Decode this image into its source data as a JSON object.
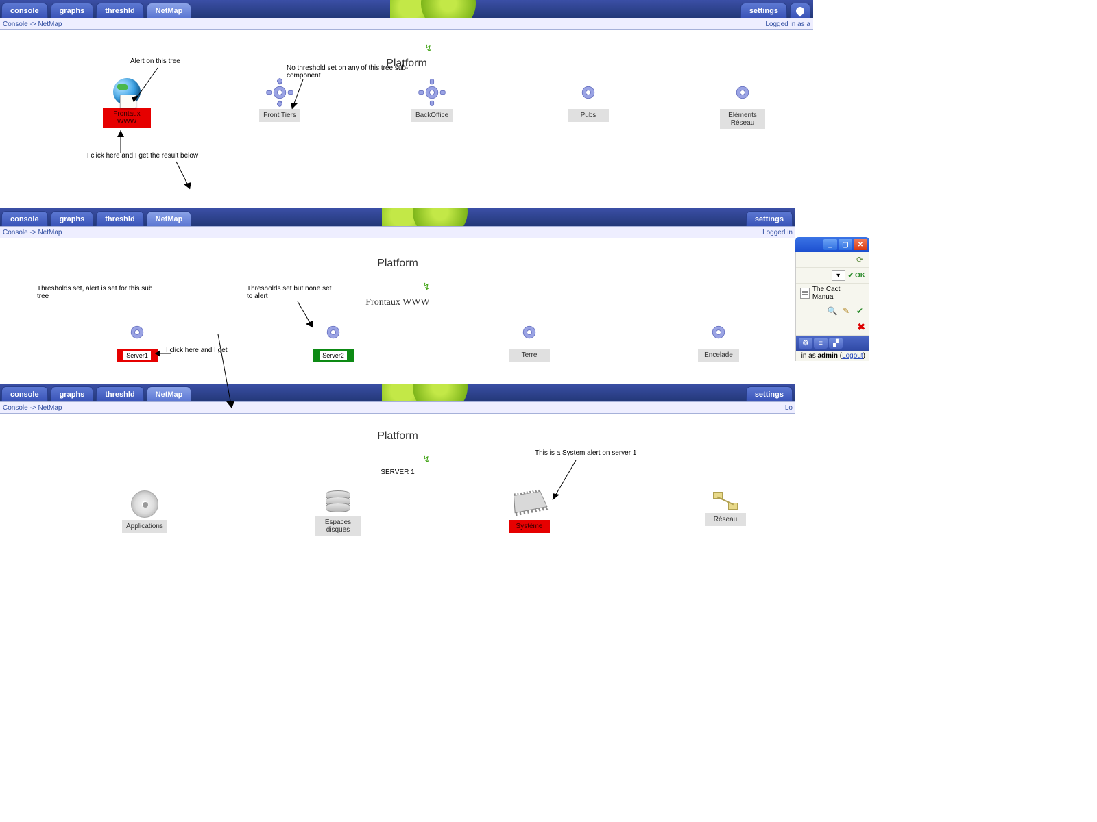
{
  "nav": {
    "tabs": [
      "console",
      "graphs",
      "threshld",
      "NetMap"
    ],
    "active": "NetMap",
    "settings": "settings"
  },
  "breadcrumb": {
    "console": "Console",
    "sep": " -> ",
    "page": "NetMap",
    "logged_a": "Logged in as a",
    "logged_in": "Logged in"
  },
  "view1": {
    "title": "Platform",
    "nodes": {
      "frontaux": "Frontaux WWW",
      "fronttiers": "Front Tiers",
      "backoffice": "BackOffice",
      "pubs": "Pubs",
      "elements": "Eléments Réseau"
    },
    "ann": {
      "alert": "Alert on this tree",
      "nothresh": "No threshold set on any of this tree sub-component",
      "click": "I click here and I get the result below"
    }
  },
  "view2": {
    "title": "Platform",
    "subtitle": "Frontaux WWW",
    "nodes": {
      "s1": "Server1",
      "s2": "Server2",
      "terre": "Terre",
      "encelade": "Encelade"
    },
    "ann": {
      "thset": "Thresholds set, alert is set for this sub tree",
      "thnone": "Thresholds set but none set to alert",
      "click": "I click here and I get"
    }
  },
  "view3": {
    "title": "Platform",
    "subtitle": "SERVER 1",
    "nodes": {
      "apps": "Applications",
      "disk": "Espaces disques",
      "sys": "Système",
      "net": "Réseau"
    },
    "ann": {
      "sysalert": "This is a System alert on server 1"
    },
    "log": "Lo"
  },
  "sidebar": {
    "ok": "OK",
    "manual": "The Cacti Manual",
    "loginline_a": "in as ",
    "loginline_b": "admin",
    "loginline_c": " (",
    "loginline_d": "Logout",
    "loginline_e": ")"
  }
}
